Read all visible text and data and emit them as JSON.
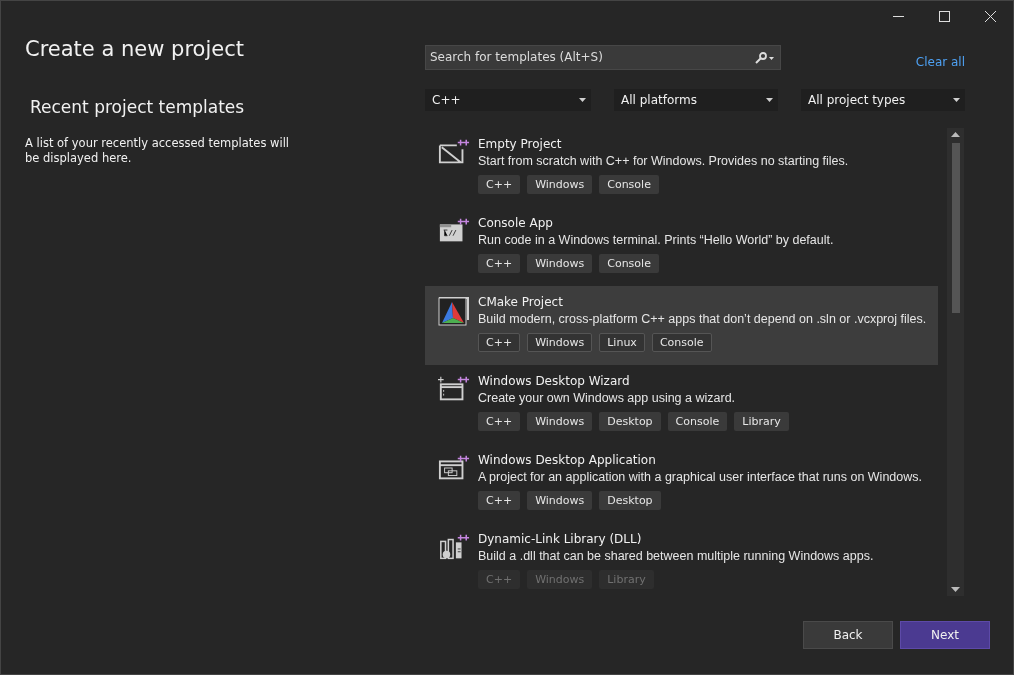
{
  "window": {
    "title": "Create a new project"
  },
  "recent": {
    "heading": "Recent project templates",
    "description": "A list of your recently accessed templates will be displayed here."
  },
  "search": {
    "placeholder": "Search for templates (Alt+S)"
  },
  "clear_all": "Clear all",
  "filters": [
    {
      "value": "C++"
    },
    {
      "value": "All platforms"
    },
    {
      "value": "All project types"
    }
  ],
  "templates": [
    {
      "title": "Empty Project",
      "description": "Start from scratch with C++ for Windows. Provides no starting files.",
      "tags": [
        "C++",
        "Windows",
        "Console"
      ],
      "selected": false,
      "faded": false
    },
    {
      "title": "Console App",
      "description": "Run code in a Windows terminal. Prints “Hello World” by default.",
      "tags": [
        "C++",
        "Windows",
        "Console"
      ],
      "selected": false,
      "faded": false
    },
    {
      "title": "CMake Project",
      "description": "Build modern, cross-platform C++ apps that don’t depend on .sln or .vcxproj files.",
      "tags": [
        "C++",
        "Windows",
        "Linux",
        "Console"
      ],
      "selected": true,
      "faded": false
    },
    {
      "title": "Windows Desktop Wizard",
      "description": "Create your own Windows app using a wizard.",
      "tags": [
        "C++",
        "Windows",
        "Desktop",
        "Console",
        "Library"
      ],
      "selected": false,
      "faded": false
    },
    {
      "title": "Windows Desktop Application",
      "description": "A project for an application with a graphical user interface that runs on Windows.",
      "tags": [
        "C++",
        "Windows",
        "Desktop"
      ],
      "selected": false,
      "faded": false
    },
    {
      "title": "Dynamic-Link Library (DLL)",
      "description": "Build a .dll that can be shared between multiple running Windows apps.",
      "tags": [
        "C++",
        "Windows",
        "Library"
      ],
      "selected": false,
      "faded": true
    }
  ],
  "buttons": [
    {
      "label": "Back",
      "kind": "secondary"
    },
    {
      "label": "Next",
      "kind": "primary"
    }
  ]
}
